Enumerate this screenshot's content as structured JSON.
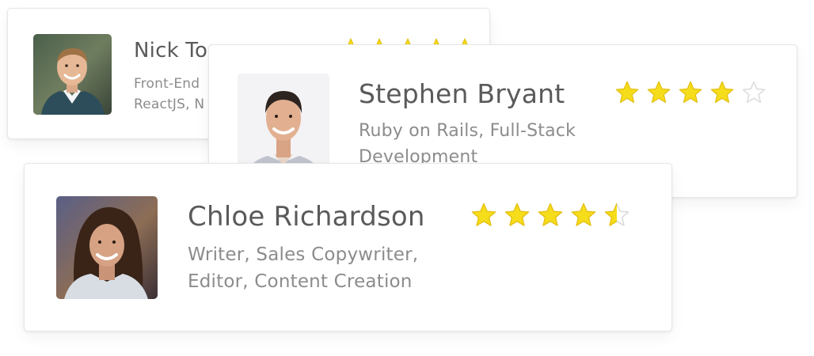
{
  "cards": [
    {
      "name": "Nick To",
      "skills_line1": "Front-End",
      "skills_line2": "ReactJS, N",
      "rating": 5,
      "avatar_icon": "profile-photo"
    },
    {
      "name": "Stephen Bryant",
      "skills_line1": "Ruby on Rails, Full-Stack",
      "skills_line2": "Development",
      "rating": 4,
      "avatar_icon": "profile-photo"
    },
    {
      "name": "Chloe Richardson",
      "skills_line1": "Writer, Sales Copywriter,",
      "skills_line2": "Editor, Content Creation",
      "rating": 4.5,
      "avatar_icon": "profile-photo"
    }
  ],
  "colors": {
    "star_filled": "#f5dd1c",
    "star_stroke": "#e8c40e",
    "star_empty_stroke": "#dddddd",
    "name_text": "#5a5a5a",
    "skills_text": "#8c8c8c"
  },
  "max_rating": 5
}
